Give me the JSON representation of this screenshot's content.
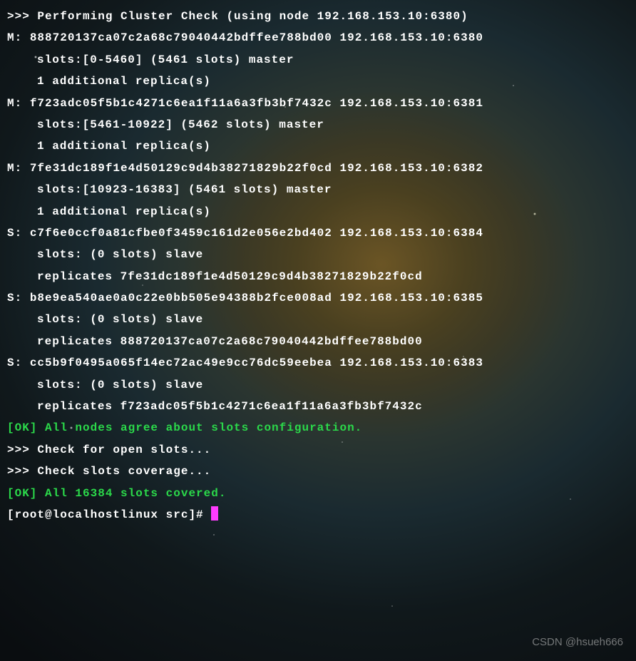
{
  "header": ">>> Performing Cluster Check (using node 192.168.153.10:6380)",
  "nodes": [
    {
      "type": "M",
      "hash": "888720137ca07c2a68c79040442bdffee788bd00",
      "addr": "192.168.153.10:6380",
      "slots": "slots:[0-5460] (5461 slots) master",
      "extra": "1 additional replica(s)"
    },
    {
      "type": "M",
      "hash": "f723adc05f5b1c4271c6ea1f11a6a3fb3bf7432c",
      "addr": "192.168.153.10:6381",
      "slots": "slots:[5461-10922] (5462 slots) master",
      "extra": "1 additional replica(s)"
    },
    {
      "type": "M",
      "hash": "7fe31dc189f1e4d50129c9d4b38271829b22f0cd",
      "addr": "192.168.153.10:6382",
      "slots": "slots:[10923-16383] (5461 slots) master",
      "extra": "1 additional replica(s)"
    },
    {
      "type": "S",
      "hash": "c7f6e0ccf0a81cfbe0f3459c161d2e056e2bd402",
      "addr": "192.168.153.10:6384",
      "slots": "slots: (0 slots) slave",
      "extra": "replicates 7fe31dc189f1e4d50129c9d4b38271829b22f0cd"
    },
    {
      "type": "S",
      "hash": "b8e9ea540ae0a0c22e0bb505e94388b2fce008ad",
      "addr": "192.168.153.10:6385",
      "slots": "slots: (0 slots) slave",
      "extra": "replicates 888720137ca07c2a68c79040442bdffee788bd00"
    },
    {
      "type": "S",
      "hash": "cc5b9f0495a065f14ec72ac49e9cc76dc59eebea",
      "addr": "192.168.153.10:6383",
      "slots": "slots: (0 slots) slave",
      "extra": "replicates f723adc05f5b1c4271c6ea1f11a6a3fb3bf7432c"
    }
  ],
  "msgs": {
    "ok_nodes": "[OK] All nodes agree about slots configuration.",
    "check_open": ">>> Check for open slots...",
    "check_cov": ">>> Check slots coverage...",
    "ok_cov": "[OK] All 16384 slots covered."
  },
  "prompt": "[root@localhostlinux src]# ",
  "watermark": "CSDN @hsueh666"
}
